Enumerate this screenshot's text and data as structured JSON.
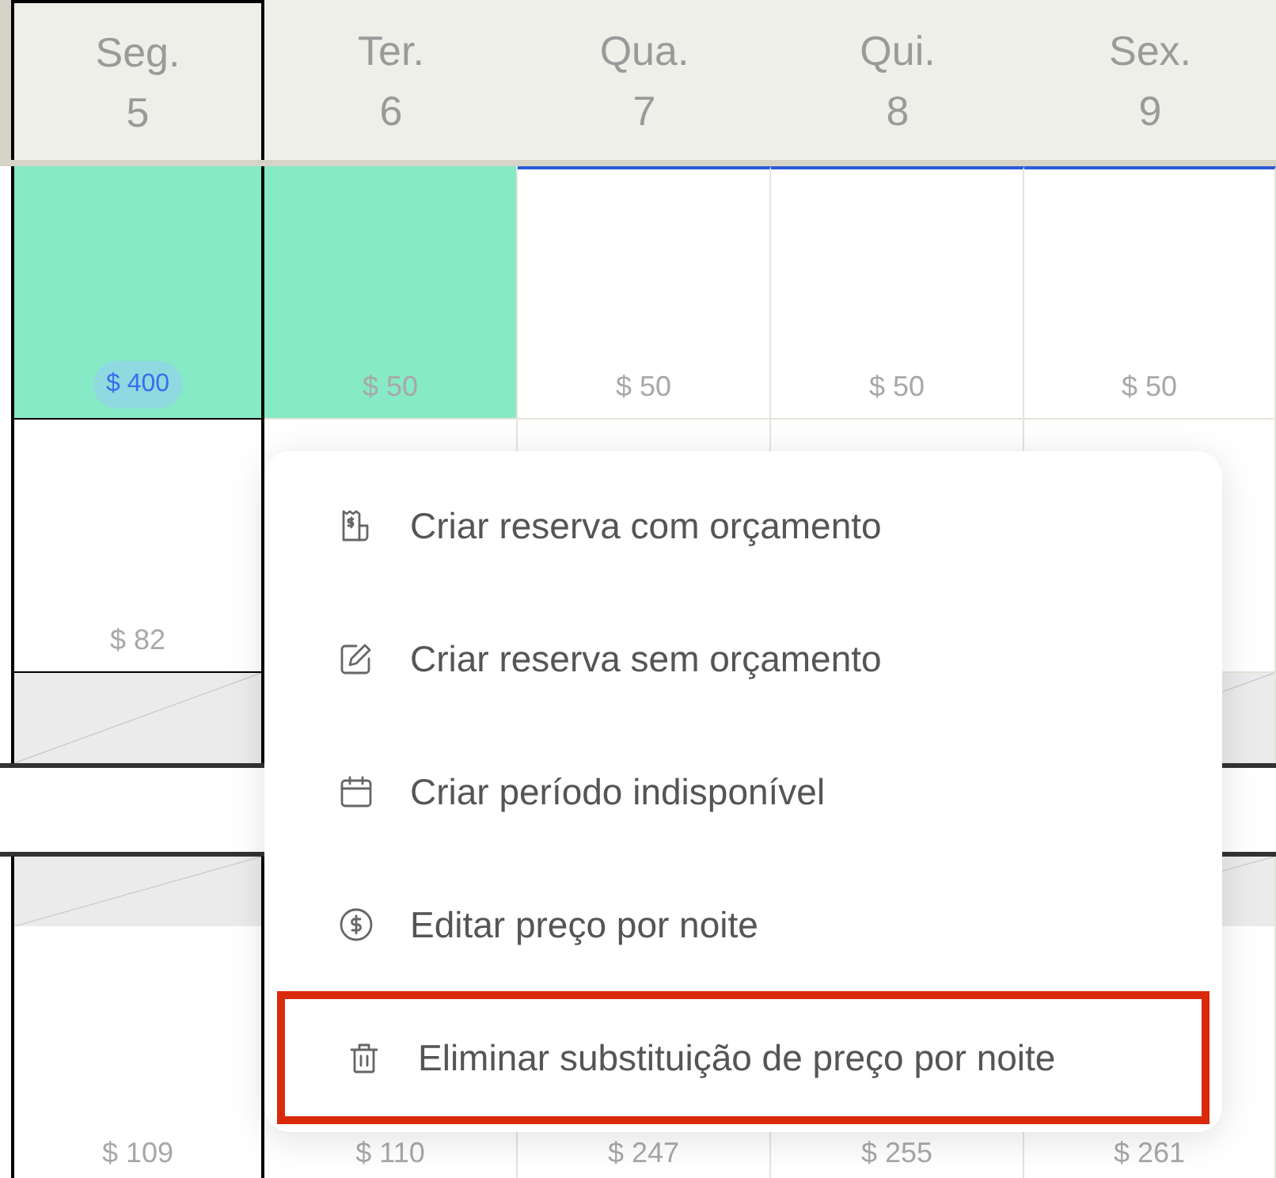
{
  "days": [
    {
      "weekday": "Seg.",
      "day": "5",
      "selected": true
    },
    {
      "weekday": "Ter.",
      "day": "6",
      "selected": false
    },
    {
      "weekday": "Qua.",
      "day": "7",
      "selected": false
    },
    {
      "weekday": "Qui.",
      "day": "8",
      "selected": false
    },
    {
      "weekday": "Sex.",
      "day": "9",
      "selected": false
    }
  ],
  "sections": [
    {
      "rows": [
        {
          "kind": "price",
          "cells": [
            {
              "price": "$ 400",
              "booked": true,
              "overridden": true,
              "marked": false
            },
            {
              "price": "$ 50",
              "booked": true,
              "overridden": false,
              "marked": false
            },
            {
              "price": "$ 50",
              "booked": false,
              "overridden": false,
              "marked": true
            },
            {
              "price": "$ 50",
              "booked": false,
              "overridden": false,
              "marked": true
            },
            {
              "price": "$ 50",
              "booked": false,
              "overridden": false,
              "marked": true
            }
          ]
        },
        {
          "kind": "price",
          "cells": [
            {
              "price": "$ 82"
            },
            {},
            {},
            {},
            {}
          ]
        },
        {
          "kind": "blocked",
          "cells": [
            {
              "kind": "blocked"
            },
            {
              "kind": "covered"
            },
            {
              "kind": "covered"
            },
            {
              "kind": "covered"
            },
            {
              "kind": "blocked"
            }
          ]
        }
      ]
    },
    {
      "rows": [
        {
          "kind": "blocked",
          "cells": [
            {
              "kind": "blocked"
            },
            {
              "kind": "covered"
            },
            {
              "kind": "covered"
            },
            {
              "kind": "covered"
            },
            {
              "kind": "blocked"
            }
          ]
        },
        {
          "kind": "price",
          "cells": [
            {
              "price": "$ 109"
            },
            {
              "price": "$ 110"
            },
            {
              "price": "$ 247"
            },
            {
              "price": "$ 255"
            },
            {
              "price": "$ 261"
            }
          ]
        }
      ]
    }
  ],
  "menu": {
    "items": [
      {
        "kind": "receipt",
        "label": "Criar reserva com orçamento",
        "highlighted": false
      },
      {
        "kind": "edit",
        "label": "Criar reserva sem orçamento",
        "highlighted": false
      },
      {
        "kind": "calendar",
        "label": "Criar período indisponível",
        "highlighted": false
      },
      {
        "kind": "dollar",
        "label": "Editar preço por noite",
        "highlighted": false
      },
      {
        "kind": "trash",
        "label": "Eliminar substituição de preço por noite",
        "highlighted": true
      }
    ]
  }
}
